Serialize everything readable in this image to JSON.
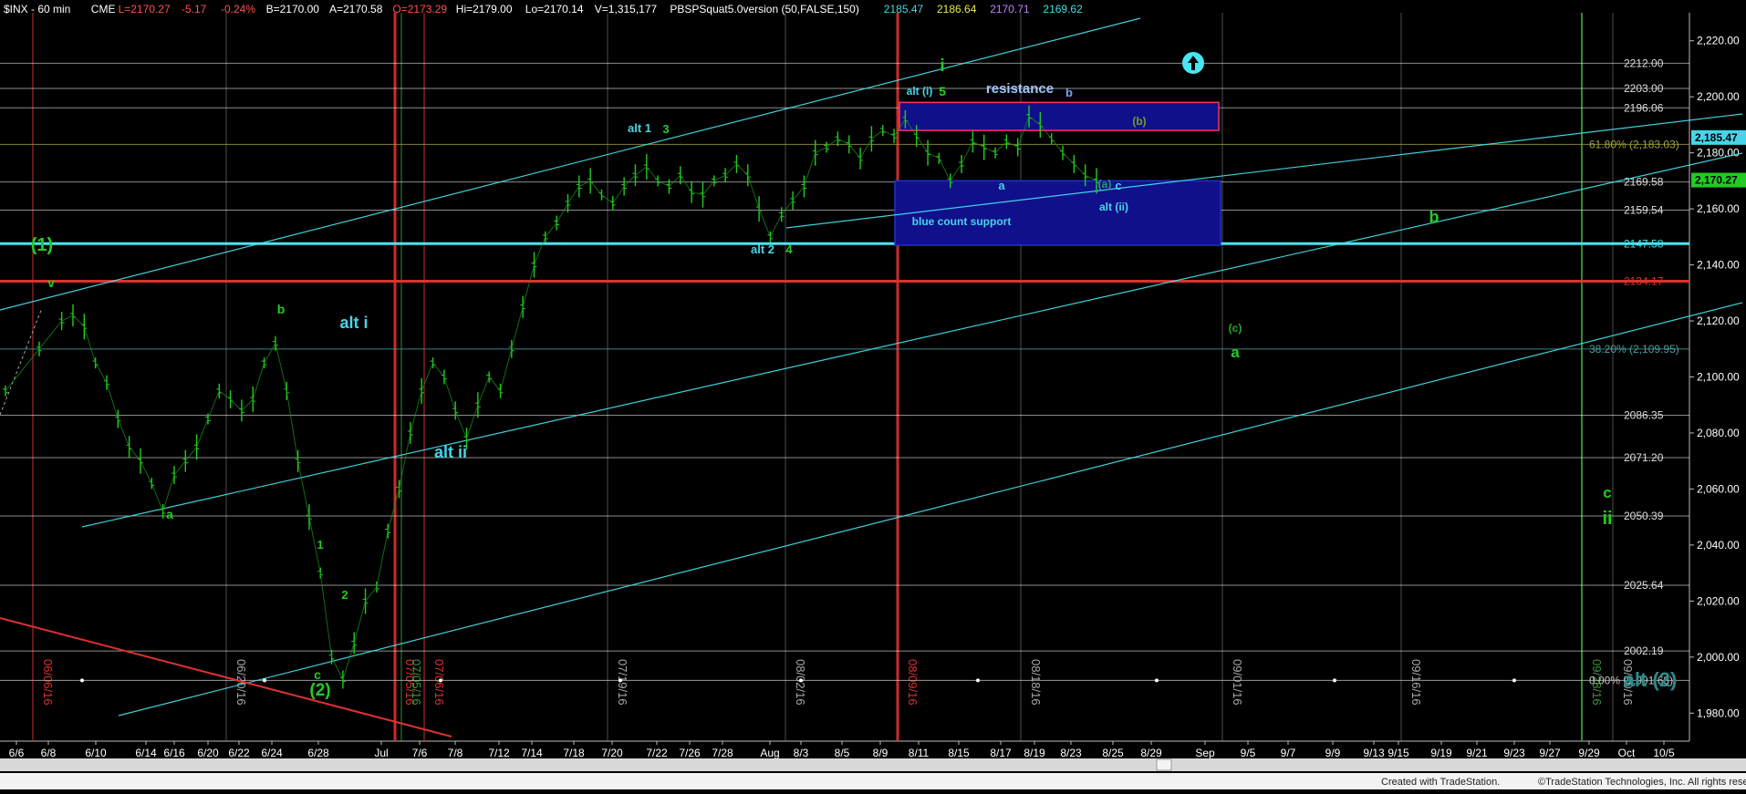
{
  "header": {
    "symbol": "$INX - 60 min",
    "exchange": "CME",
    "last": "L=2170.27",
    "change": "-5.17",
    "pct": "-0.24%",
    "bid": "B=2170.00",
    "ask": "A=2170.58",
    "open": "O=2173.29",
    "high": "Hi=2179.00",
    "low": "Lo=2170.14",
    "volume": "V=1,315,177",
    "indicator": "PBSPSquat5.0version (50,FALSE,150)",
    "ind_values": [
      "2185.47",
      "2186.64",
      "2170.71",
      "2169.62"
    ],
    "ind_colors": [
      "#47d4e8",
      "#e8e84a",
      "#c080ff",
      "#46e0e0"
    ]
  },
  "footer": {
    "created": "Created with TradeStation.",
    "copyright": "©TradeStation Technologies, Inc. All rights reserved."
  },
  "chart_data": {
    "type": "line",
    "title": "$INX - 60 min",
    "ylim": [
      1970,
      2230
    ],
    "y_ticks": [
      1980,
      2000,
      2020,
      2040,
      2060,
      2080,
      2100,
      2120,
      2140,
      2160,
      2180,
      2200,
      2220
    ],
    "x_ticks": [
      "6/6",
      "6/8",
      "6/10",
      "6/14",
      "6/16",
      "6/20",
      "6/22",
      "6/24",
      "6/28",
      "Jul",
      "7/6",
      "7/8",
      "7/12",
      "7/14",
      "7/18",
      "7/20",
      "7/22",
      "7/26",
      "7/28",
      "Aug",
      "8/3",
      "8/5",
      "8/9",
      "8/11",
      "8/15",
      "8/17",
      "8/19",
      "8/23",
      "8/25",
      "8/29",
      "Sep",
      "9/5",
      "9/7",
      "9/9",
      "9/13",
      "9/15",
      "9/19",
      "9/21",
      "9/23",
      "9/27",
      "9/29",
      "Oct",
      "10/5"
    ],
    "date_lines": [
      {
        "label": "06/06/16",
        "color": "#e03030"
      },
      {
        "label": "06/20/16",
        "color": "#aaaaaa"
      },
      {
        "label": "07/05/16",
        "color": "#e03030"
      },
      {
        "label": "07/05/16",
        "color": "#3a9a3a"
      },
      {
        "label": "07/06/16",
        "color": "#e03030"
      },
      {
        "label": "07/19/16",
        "color": "#aaaaaa"
      },
      {
        "label": "08/02/16",
        "color": "#aaaaaa"
      },
      {
        "label": "08/09/16",
        "color": "#e03030"
      },
      {
        "label": "08/18/16",
        "color": "#aaaaaa"
      },
      {
        "label": "09/01/16",
        "color": "#aaaaaa"
      },
      {
        "label": "09/16/16",
        "color": "#aaaaaa"
      },
      {
        "label": "09/28/16",
        "color": "#3a9a3a"
      },
      {
        "label": "09/30/16",
        "color": "#aaaaaa"
      }
    ],
    "price_levels": [
      {
        "value": 2212.0,
        "label": "2212.00",
        "color": "#ffffff"
      },
      {
        "value": 2203.0,
        "label": "2203.00",
        "color": "#ffffff"
      },
      {
        "value": 2196.06,
        "label": "2196.06",
        "color": "#ffffff"
      },
      {
        "value": 2169.58,
        "label": "2169.58",
        "color": "#ffffff"
      },
      {
        "value": 2159.54,
        "label": "2159.54",
        "color": "#ffffff"
      },
      {
        "value": 2147.58,
        "label": "2147.58",
        "color": "#47e6f0"
      },
      {
        "value": 2134.17,
        "label": "2134.17",
        "color": "#e03030"
      },
      {
        "value": 2086.35,
        "label": "2086.35",
        "color": "#ffffff"
      },
      {
        "value": 2071.2,
        "label": "2071.20",
        "color": "#ffffff"
      },
      {
        "value": 2050.39,
        "label": "2050.39",
        "color": "#ffffff"
      },
      {
        "value": 2025.64,
        "label": "2025.64",
        "color": "#ffffff"
      },
      {
        "value": 2002.19,
        "label": "2002.19",
        "color": "#ffffff"
      }
    ],
    "fib_levels": [
      {
        "value": 2183.03,
        "label": "61.80% (2,183.03)",
        "color": "#a0a040"
      },
      {
        "value": 2109.95,
        "label": "38.20% (2,109.95)",
        "color": "#4aa0a0"
      },
      {
        "value": 1991.68,
        "label": "0.00% (1,991.68)",
        "color": "#c0c0c0"
      }
    ],
    "last_price_tags": [
      {
        "value": 2185.47,
        "label": "2,185.47",
        "color": "#47d4e8"
      },
      {
        "value": 2170.27,
        "label": "2,170.27",
        "color": "#22cc22"
      }
    ],
    "zones": [
      {
        "label": "resistance",
        "sublabel": "alt (i)",
        "from": 2188,
        "to": 2198,
        "color": "#10108a"
      },
      {
        "label": "blue count support",
        "sublabel": "alt (ii)",
        "from": 2147,
        "to": 2170,
        "color": "#10108a"
      }
    ],
    "price_path": [
      [
        0,
        2095
      ],
      [
        3,
        2110
      ],
      [
        5,
        2120
      ],
      [
        6,
        2122
      ],
      [
        7,
        2118
      ],
      [
        8,
        2105
      ],
      [
        9,
        2098
      ],
      [
        10,
        2085
      ],
      [
        11,
        2075
      ],
      [
        12,
        2070
      ],
      [
        13,
        2062
      ],
      [
        14,
        2052
      ],
      [
        15,
        2065
      ],
      [
        16,
        2070
      ],
      [
        17,
        2075
      ],
      [
        18,
        2085
      ],
      [
        19,
        2095
      ],
      [
        20,
        2092
      ],
      [
        21,
        2088
      ],
      [
        22,
        2092
      ],
      [
        23,
        2105
      ],
      [
        24,
        2112
      ],
      [
        25,
        2095
      ],
      [
        26,
        2070
      ],
      [
        27,
        2050
      ],
      [
        28,
        2030
      ],
      [
        29,
        2000
      ],
      [
        30,
        1992
      ],
      [
        31,
        2005
      ],
      [
        32,
        2020
      ],
      [
        33,
        2025
      ],
      [
        34,
        2045
      ],
      [
        35,
        2060
      ],
      [
        36,
        2080
      ],
      [
        37,
        2095
      ],
      [
        38,
        2105
      ],
      [
        39,
        2100
      ],
      [
        40,
        2088
      ],
      [
        41,
        2078
      ],
      [
        42,
        2090
      ],
      [
        43,
        2100
      ],
      [
        44,
        2095
      ],
      [
        45,
        2110
      ],
      [
        46,
        2125
      ],
      [
        47,
        2140
      ],
      [
        48,
        2150
      ],
      [
        49,
        2155
      ],
      [
        50,
        2162
      ],
      [
        51,
        2168
      ],
      [
        52,
        2170
      ],
      [
        53,
        2165
      ],
      [
        54,
        2162
      ],
      [
        55,
        2168
      ],
      [
        56,
        2172
      ],
      [
        57,
        2175
      ],
      [
        58,
        2170
      ],
      [
        59,
        2168
      ],
      [
        60,
        2172
      ],
      [
        61,
        2166
      ],
      [
        62,
        2165
      ],
      [
        63,
        2170
      ],
      [
        64,
        2172
      ],
      [
        65,
        2176
      ],
      [
        66,
        2172
      ],
      [
        67,
        2160
      ],
      [
        68,
        2150
      ],
      [
        69,
        2158
      ],
      [
        70,
        2163
      ],
      [
        71,
        2168
      ],
      [
        72,
        2180
      ],
      [
        73,
        2182
      ],
      [
        74,
        2185
      ],
      [
        75,
        2183
      ],
      [
        76,
        2178
      ],
      [
        77,
        2185
      ],
      [
        78,
        2188
      ],
      [
        79,
        2186
      ],
      [
        80,
        2192
      ],
      [
        81,
        2186
      ],
      [
        82,
        2180
      ],
      [
        83,
        2178
      ],
      [
        84,
        2170
      ],
      [
        85,
        2176
      ],
      [
        86,
        2184
      ],
      [
        87,
        2182
      ],
      [
        88,
        2180
      ],
      [
        89,
        2184
      ],
      [
        90,
        2182
      ],
      [
        91,
        2193
      ],
      [
        92,
        2190
      ],
      [
        93,
        2185
      ],
      [
        94,
        2180
      ],
      [
        95,
        2176
      ],
      [
        96,
        2172
      ],
      [
        97,
        2170
      ]
    ],
    "wave_labels": [
      {
        "text": "(1)",
        "color": "#22cc22",
        "size": 20
      },
      {
        "text": "v",
        "color": "#22cc22",
        "size": 14
      },
      {
        "text": "a",
        "color": "#22cc22",
        "size": 14
      },
      {
        "text": "b",
        "color": "#22cc22",
        "size": 14
      },
      {
        "text": "1",
        "color": "#22cc22",
        "size": 13
      },
      {
        "text": "2",
        "color": "#22cc22",
        "size": 13
      },
      {
        "text": "c",
        "color": "#22cc22",
        "size": 14
      },
      {
        "text": "(2)",
        "color": "#22cc22",
        "size": 19
      },
      {
        "text": "alt i",
        "color": "#47d4e8",
        "size": 18
      },
      {
        "text": "alt ii",
        "color": "#47d4e8",
        "size": 18
      },
      {
        "text": "alt 1",
        "color": "#47d4e8",
        "size": 13
      },
      {
        "text": "3",
        "color": "#22cc22",
        "size": 13
      },
      {
        "text": "alt 2",
        "color": "#47d4e8",
        "size": 13
      },
      {
        "text": "4",
        "color": "#22cc22",
        "size": 13
      },
      {
        "text": "i",
        "color": "#22cc22",
        "size": 19
      },
      {
        "text": "5",
        "color": "#22cc22",
        "size": 14
      },
      {
        "text": "alt (i)",
        "color": "#47d4e8",
        "size": 12
      },
      {
        "text": "resistance",
        "color": "#9fc8ff",
        "size": 15
      },
      {
        "text": "b",
        "color": "#7aa0ff",
        "size": 13
      },
      {
        "text": "(b)",
        "color": "#7a9a2a",
        "size": 12
      },
      {
        "text": "a",
        "color": "#47d4e8",
        "size": 13
      },
      {
        "text": "(a)",
        "color": "#2a9a6a",
        "size": 12
      },
      {
        "text": "c",
        "color": "#47d4e8",
        "size": 13
      },
      {
        "text": "alt (ii)",
        "color": "#47d4e8",
        "size": 12
      },
      {
        "text": "blue count support",
        "color": "#47d4e8",
        "size": 12
      },
      {
        "text": "b",
        "color": "#22cc22",
        "size": 18
      },
      {
        "text": "(c)",
        "color": "#22aa22",
        "size": 12
      },
      {
        "text": "a",
        "color": "#22cc22",
        "size": 17
      },
      {
        "text": "c",
        "color": "#22cc22",
        "size": 17
      },
      {
        "text": "ii",
        "color": "#22cc22",
        "size": 20
      },
      {
        "text": "alt (2)",
        "color": "#2a8a8a",
        "size": 22
      }
    ]
  },
  "colors": {
    "background": "#000000",
    "grid": "#555555",
    "cyan": "#47e6f0",
    "red": "#e03030",
    "green": "#22cc22"
  }
}
